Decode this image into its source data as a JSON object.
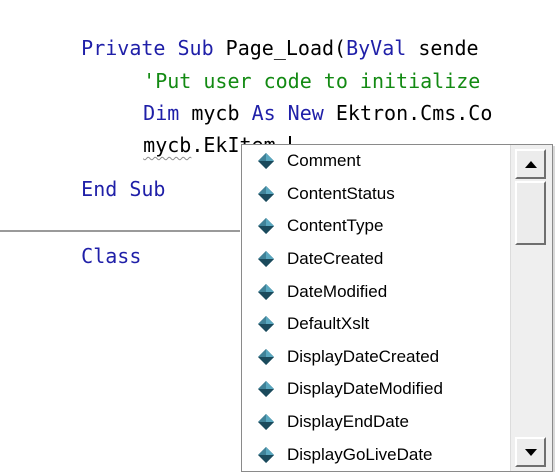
{
  "code": {
    "line1": {
      "kw1": "Private Sub ",
      "text": "Page_Load(",
      "kw2": "ByVal ",
      "text2": "sende"
    },
    "line2": {
      "comment": "'Put user code to initialize"
    },
    "line3": {
      "kw1": "Dim ",
      "text1": "mycb ",
      "kw2": "As New ",
      "text2": "Ektron.Cms.Co"
    },
    "line4": {
      "ident": "mycb",
      "text": ".EkItem."
    },
    "line5": {
      "kw": "End Sub"
    },
    "line6": {
      "kw": "Class"
    }
  },
  "completion_list": {
    "items": [
      {
        "label": "Comment",
        "icon": "property-icon"
      },
      {
        "label": "ContentStatus",
        "icon": "property-icon"
      },
      {
        "label": "ContentType",
        "icon": "property-icon"
      },
      {
        "label": "DateCreated",
        "icon": "property-icon"
      },
      {
        "label": "DateModified",
        "icon": "property-icon"
      },
      {
        "label": "DefaultXslt",
        "icon": "property-icon"
      },
      {
        "label": "DisplayDateCreated",
        "icon": "property-icon"
      },
      {
        "label": "DisplayDateModified",
        "icon": "property-icon"
      },
      {
        "label": "DisplayEndDate",
        "icon": "property-icon"
      },
      {
        "label": "DisplayGoLiveDate",
        "icon": "property-icon"
      }
    ],
    "icon_colors": {
      "dark": "#1a4a5c",
      "light": "#5aa8c0"
    }
  },
  "colors": {
    "keyword": "#1f1fa8",
    "comment": "#138a13",
    "text": "#000000"
  }
}
